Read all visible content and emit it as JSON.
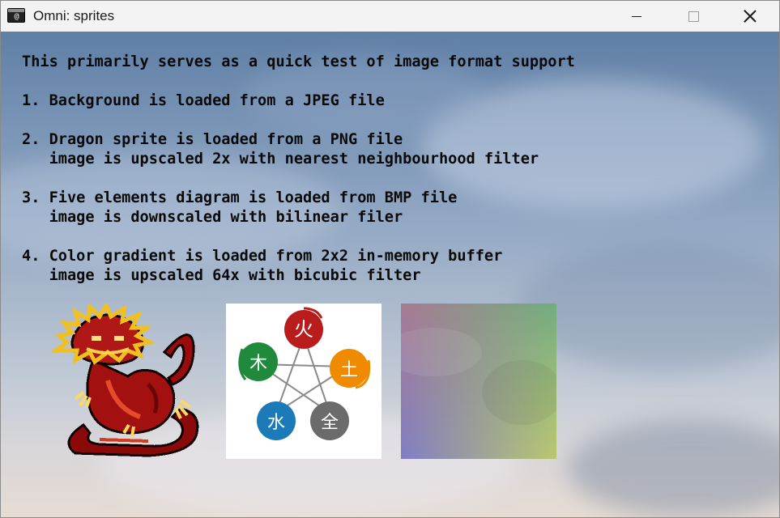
{
  "window": {
    "title": "Omni: sprites",
    "icon": "console-app-icon",
    "icon_glyph": "@",
    "controls": [
      "minimize",
      "maximize",
      "close"
    ]
  },
  "content": {
    "lines": [
      "This primarily serves as a quick test of image format support",
      "",
      "1. Background is loaded from a JPEG file",
      "",
      "2. Dragon sprite is loaded from a PNG file",
      "   image is upscaled 2x with nearest neighbourhood filter",
      "",
      "3. Five elements diagram is loaded from BMP file",
      "   image is downscaled with bilinear filer",
      "",
      "4. Color gradient is loaded from 2x2 in-memory buffer",
      "   image is upscaled 64x with bicubic filter"
    ]
  },
  "sprites": {
    "dragon": {
      "icon": "dragon-sprite"
    },
    "five_elements": {
      "fire": "火",
      "earth": "土",
      "metal": "全",
      "water": "水",
      "wood": "木",
      "colors": {
        "fire": "#b81c1c",
        "earth": "#f08a00",
        "metal": "#6b6b6b",
        "water": "#1a7bb8",
        "wood": "#1f8a3b"
      }
    },
    "gradient": {
      "colors": {
        "top_left": "#a8738c",
        "top_right": "#6eaf78",
        "bottom_left": "#7d7dc8",
        "bottom_right": "#bec86e"
      }
    }
  }
}
